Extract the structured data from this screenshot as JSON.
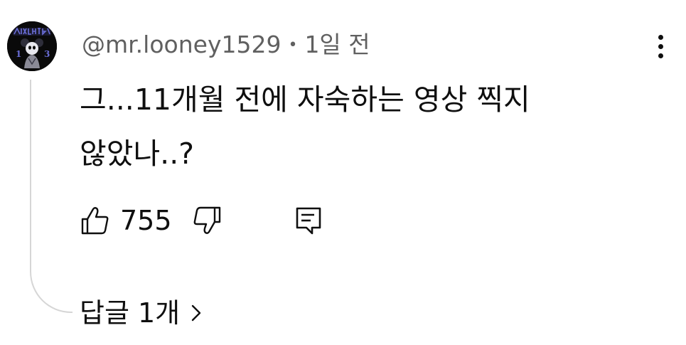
{
  "comment": {
    "author": "@mr.looney1529",
    "separator": "•",
    "time_ago": "1일 전",
    "text": "그...11개월 전에 자숙하는 영상 찍지 않았나..?",
    "likes": "755"
  },
  "avatar": {
    "lettering": "LOONEY",
    "numbers": [
      "1",
      "3"
    ]
  },
  "replies": {
    "label": "답글 1개"
  },
  "icons": {
    "menu": "kebab-icon",
    "like": "thumb-up-outline-icon",
    "dislike": "thumb-down-outline-icon",
    "reply": "comment-reply-icon",
    "expand": "chevron-right-icon"
  },
  "colors": {
    "text": "#0f0f0f",
    "meta": "#606060",
    "thread_line": "#d6d6d6",
    "avatar_bg": "#0a0a0a",
    "avatar_accent": "#6a6ed8"
  }
}
